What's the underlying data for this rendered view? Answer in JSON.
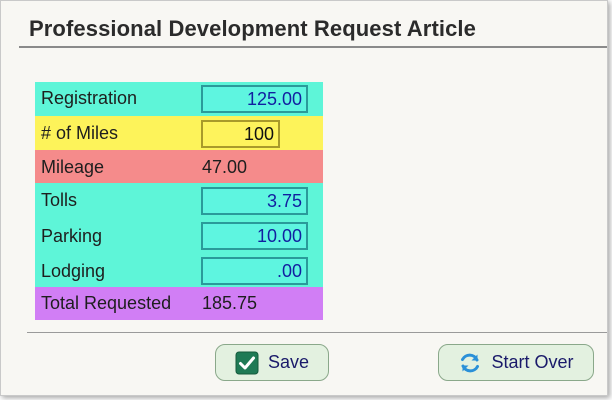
{
  "title": "Professional Development Request Article",
  "rows": [
    {
      "label": "Registration",
      "value": "125.00"
    },
    {
      "label": "# of Miles",
      "value": "100"
    },
    {
      "label": "Mileage",
      "value": "47.00"
    },
    {
      "label": "Tolls",
      "value": "3.75"
    },
    {
      "label": "Parking",
      "value": "10.00"
    },
    {
      "label": "Lodging",
      "value": ".00"
    },
    {
      "label": "Total Requested",
      "value": "185.75"
    }
  ],
  "buttons": {
    "save": {
      "label": "Save",
      "icon": "checkbox-checked-icon"
    },
    "start_over": {
      "label": "Start Over",
      "icon": "refresh-icon"
    }
  },
  "colors": {
    "teal": "#5ef5d8",
    "yellow": "#fdf35a",
    "pink": "#f58b8b",
    "purple": "#d17ef5",
    "input_text": "#121fa0",
    "button_bg": "#e3f1e0"
  }
}
